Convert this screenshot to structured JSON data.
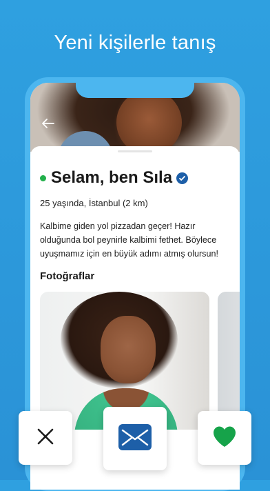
{
  "headline": "Yeni kişilerle tanış",
  "profile": {
    "name": "Selam, ben Sıla",
    "meta": "25 yaşında, İstanbul (2 km)",
    "bio": "Kalbime giden yol pizzadan geçer! Hazır olduğunda bol peynirle kalbimi fethet. Böylece uyuşmamız için en büyük adımı atmış olursun!",
    "photos_title": "Fotoğraflar",
    "online_color": "#22b04b",
    "verified_color": "#1d5fa8"
  },
  "actions": {
    "close_icon": "close-icon",
    "message_icon": "envelope-icon",
    "like_icon": "heart-icon",
    "like_color": "#16a34a",
    "message_color": "#1d5fa8"
  }
}
